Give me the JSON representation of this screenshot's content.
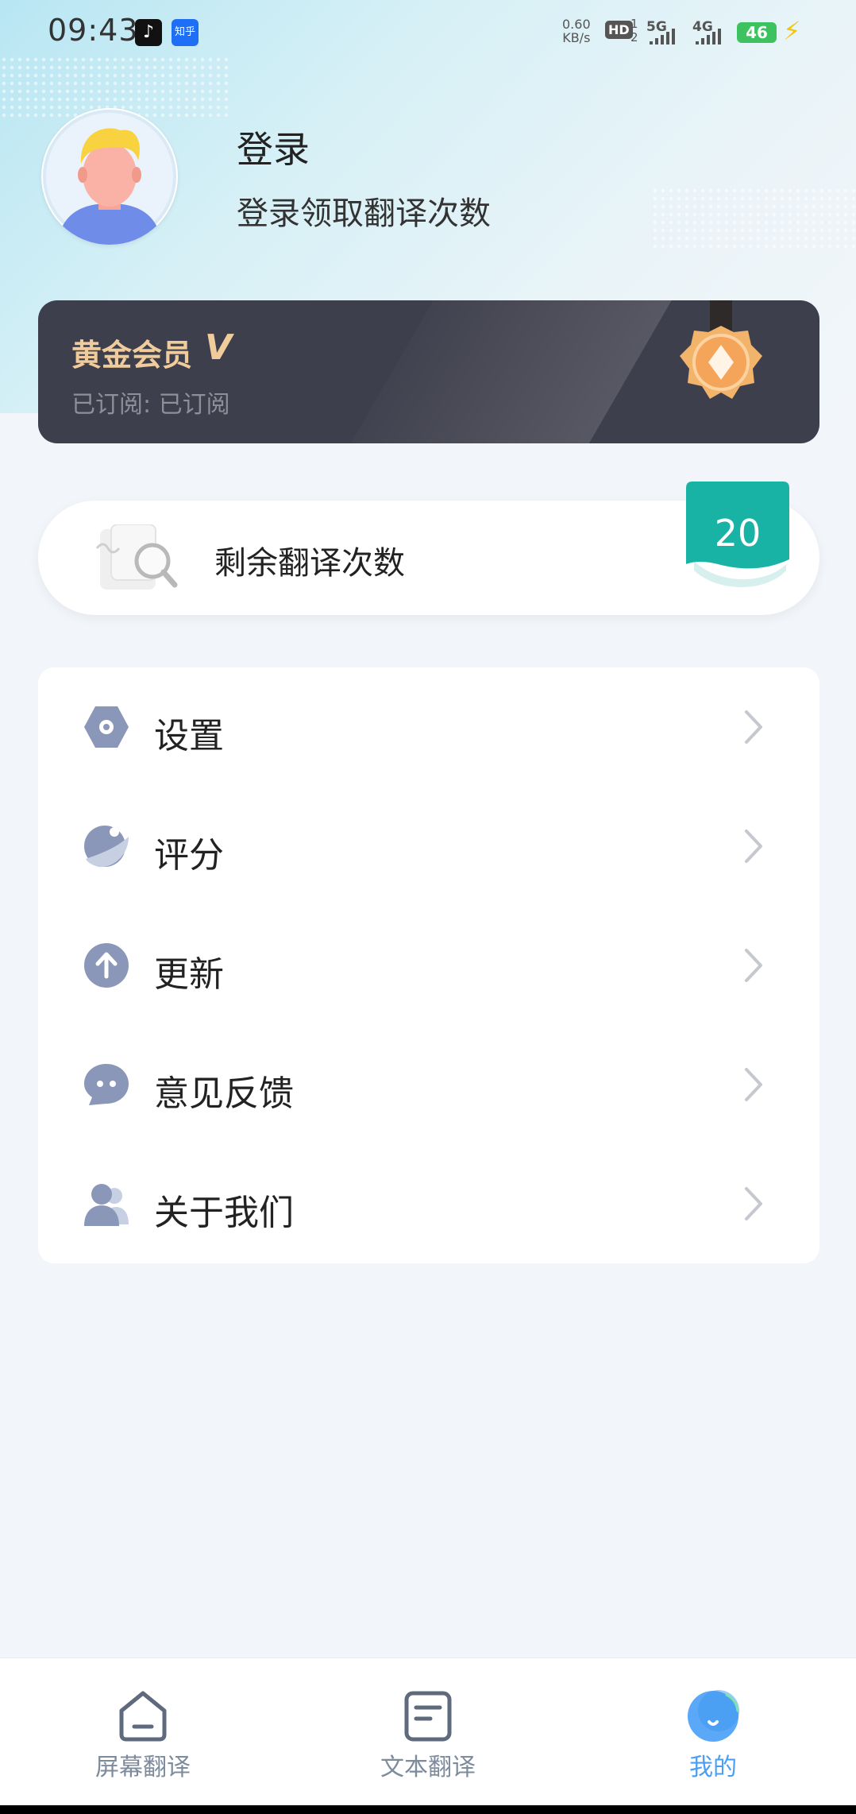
{
  "status_bar": {
    "time": "09:43",
    "app_icon_1": "tiktok-icon",
    "app_icon_2": "知乎",
    "net_speed_value": "0.60",
    "net_speed_unit": "KB/s",
    "hd_label": "HD",
    "hd_sub_top": "1",
    "hd_sub_bottom": "2",
    "sig1_label": "5G",
    "sig2_label": "4G",
    "battery": "46",
    "colors": {
      "battery": "#3cc35f",
      "bolt": "#f3c316"
    }
  },
  "profile": {
    "avatar_icon": "user-avatar-icon",
    "title": "登录",
    "subtitle": "登录领取翻译次数"
  },
  "vip": {
    "title": "黄金会员",
    "check": "V",
    "subtitle": "已订阅: 已订阅",
    "icon": "medal-icon",
    "colors": {
      "card": "#3e3f4c",
      "title": "#f0cc9c"
    }
  },
  "remaining": {
    "label": "剩余翻译次数",
    "count": "20",
    "icon": "document-search-icon",
    "colors": {
      "badge": "#19b3a5"
    }
  },
  "menu": {
    "items": [
      {
        "label": "设置",
        "icon": "settings-icon"
      },
      {
        "label": "评分",
        "icon": "planet-rating-icon"
      },
      {
        "label": "更新",
        "icon": "arrow-up-circle-icon"
      },
      {
        "label": "意见反馈",
        "icon": "chat-bubble-icon"
      },
      {
        "label": "关于我们",
        "icon": "users-icon"
      }
    ],
    "chevron_icon": "chevron-right-icon"
  },
  "bottom_nav": {
    "items": [
      {
        "label": "屏幕翻译",
        "icon": "home-icon",
        "active": false
      },
      {
        "label": "文本翻译",
        "icon": "document-icon",
        "active": false
      },
      {
        "label": "我的",
        "icon": "profile-smile-icon",
        "active": true
      }
    ],
    "colors": {
      "active": "#4a9ef5",
      "inactive": "#7d8b9c"
    }
  }
}
